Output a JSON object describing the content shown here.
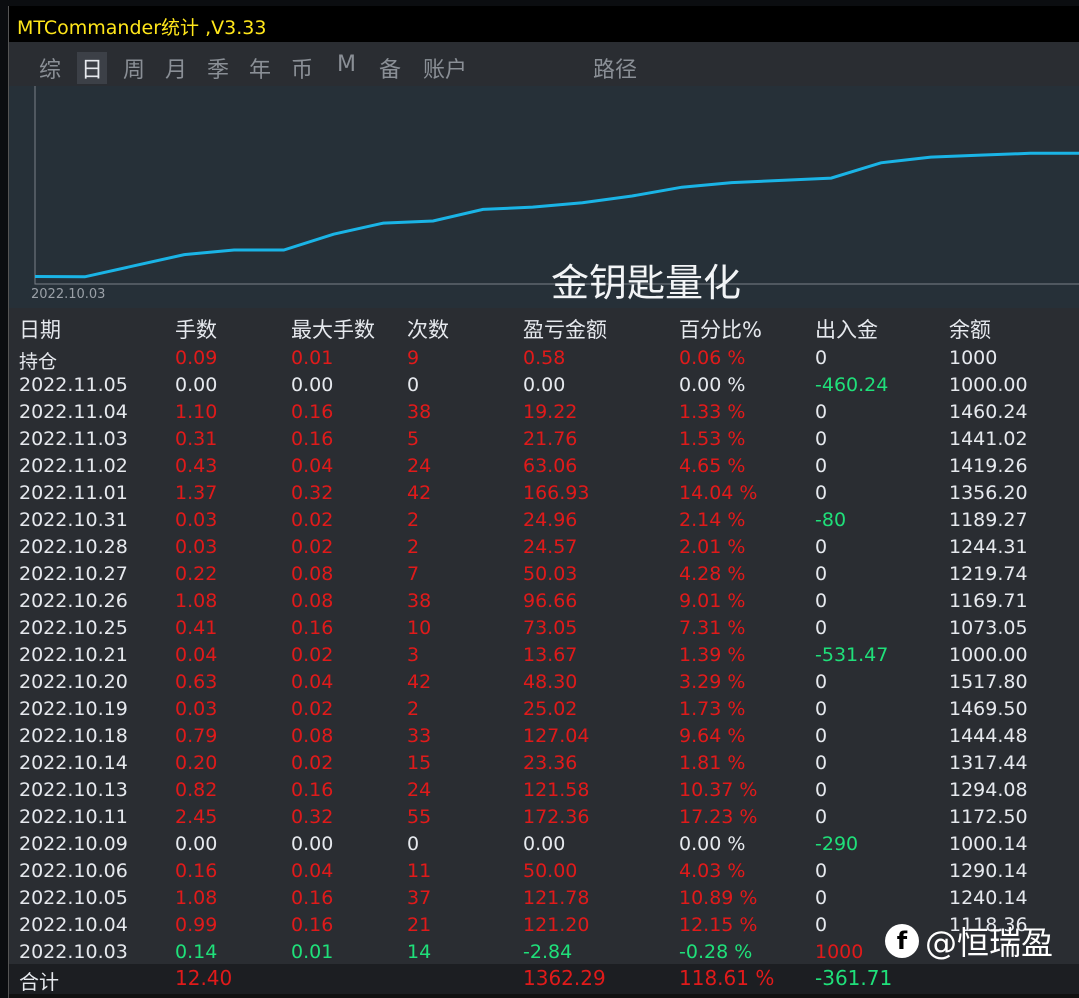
{
  "window": {
    "title": "MTCommander统计 ,V3.33"
  },
  "tabs": [
    {
      "label": "综",
      "active": false
    },
    {
      "label": "日",
      "active": true
    },
    {
      "label": "周",
      "active": false
    },
    {
      "label": "月",
      "active": false
    },
    {
      "label": "季",
      "active": false
    },
    {
      "label": "年",
      "active": false
    },
    {
      "label": "币",
      "active": false
    },
    {
      "label": "M",
      "active": false
    },
    {
      "label": "备",
      "active": false
    },
    {
      "label": "账户",
      "active": false
    },
    {
      "label": "路径",
      "active": false
    }
  ],
  "chart": {
    "start_date": "2022.10.03",
    "watermark": "金钥匙量化",
    "line_color": "#1ab4e6"
  },
  "chart_data": {
    "type": "line",
    "x": [
      "2022.10.03",
      "2022.10.04",
      "2022.10.05",
      "2022.10.06",
      "2022.10.09",
      "2022.10.11",
      "2022.10.13",
      "2022.10.14",
      "2022.10.18",
      "2022.10.19",
      "2022.10.20",
      "2022.10.21",
      "2022.10.25",
      "2022.10.26",
      "2022.10.27",
      "2022.10.28",
      "2022.10.31",
      "2022.11.01",
      "2022.11.02",
      "2022.11.03",
      "2022.11.04",
      "2022.11.05"
    ],
    "series": [
      {
        "values": [
          0,
          -2.84,
          118.36,
          240.14,
          290.14,
          290.14,
          462.5,
          584.08,
          607.44,
          734.48,
          759.5,
          807.8,
          880.85,
          977.51,
          1027.54,
          1052.11,
          1077.07,
          1244.0,
          1307.06,
          1328.82,
          1348.04,
          1348.04
        ]
      }
    ],
    "grid": false
  },
  "table": {
    "headers": [
      "日期",
      "手数",
      "最大手数",
      "次数",
      "盈亏金额",
      "百分比%",
      "出入金",
      "余额"
    ],
    "rows": [
      {
        "date": "持仓",
        "lots": "0.09",
        "max_lots": "0.01",
        "count": "9",
        "pnl": "0.58",
        "pct": "0.06 %",
        "flow": "0",
        "balance": "1000",
        "tone": "red",
        "flow_tone": "white"
      },
      {
        "date": "2022.11.05",
        "lots": "0.00",
        "max_lots": "0.00",
        "count": "0",
        "pnl": "0.00",
        "pct": "0.00 %",
        "flow": "-460.24",
        "balance": "1000.00",
        "tone": "white",
        "flow_tone": "green"
      },
      {
        "date": "2022.11.04",
        "lots": "1.10",
        "max_lots": "0.16",
        "count": "38",
        "pnl": "19.22",
        "pct": "1.33 %",
        "flow": "0",
        "balance": "1460.24",
        "tone": "red",
        "flow_tone": "white"
      },
      {
        "date": "2022.11.03",
        "lots": "0.31",
        "max_lots": "0.16",
        "count": "5",
        "pnl": "21.76",
        "pct": "1.53 %",
        "flow": "0",
        "balance": "1441.02",
        "tone": "red",
        "flow_tone": "white"
      },
      {
        "date": "2022.11.02",
        "lots": "0.43",
        "max_lots": "0.04",
        "count": "24",
        "pnl": "63.06",
        "pct": "4.65 %",
        "flow": "0",
        "balance": "1419.26",
        "tone": "red",
        "flow_tone": "white"
      },
      {
        "date": "2022.11.01",
        "lots": "1.37",
        "max_lots": "0.32",
        "count": "42",
        "pnl": "166.93",
        "pct": "14.04 %",
        "flow": "0",
        "balance": "1356.20",
        "tone": "red",
        "flow_tone": "white"
      },
      {
        "date": "2022.10.31",
        "lots": "0.03",
        "max_lots": "0.02",
        "count": "2",
        "pnl": "24.96",
        "pct": "2.14 %",
        "flow": "-80",
        "balance": "1189.27",
        "tone": "red",
        "flow_tone": "green"
      },
      {
        "date": "2022.10.28",
        "lots": "0.03",
        "max_lots": "0.02",
        "count": "2",
        "pnl": "24.57",
        "pct": "2.01 %",
        "flow": "0",
        "balance": "1244.31",
        "tone": "red",
        "flow_tone": "white"
      },
      {
        "date": "2022.10.27",
        "lots": "0.22",
        "max_lots": "0.08",
        "count": "7",
        "pnl": "50.03",
        "pct": "4.28 %",
        "flow": "0",
        "balance": "1219.74",
        "tone": "red",
        "flow_tone": "white"
      },
      {
        "date": "2022.10.26",
        "lots": "1.08",
        "max_lots": "0.08",
        "count": "38",
        "pnl": "96.66",
        "pct": "9.01 %",
        "flow": "0",
        "balance": "1169.71",
        "tone": "red",
        "flow_tone": "white"
      },
      {
        "date": "2022.10.25",
        "lots": "0.41",
        "max_lots": "0.16",
        "count": "10",
        "pnl": "73.05",
        "pct": "7.31 %",
        "flow": "0",
        "balance": "1073.05",
        "tone": "red",
        "flow_tone": "white"
      },
      {
        "date": "2022.10.21",
        "lots": "0.04",
        "max_lots": "0.02",
        "count": "3",
        "pnl": "13.67",
        "pct": "1.39 %",
        "flow": "-531.47",
        "balance": "1000.00",
        "tone": "red",
        "flow_tone": "green"
      },
      {
        "date": "2022.10.20",
        "lots": "0.63",
        "max_lots": "0.04",
        "count": "42",
        "pnl": "48.30",
        "pct": "3.29 %",
        "flow": "0",
        "balance": "1517.80",
        "tone": "red",
        "flow_tone": "white"
      },
      {
        "date": "2022.10.19",
        "lots": "0.03",
        "max_lots": "0.02",
        "count": "2",
        "pnl": "25.02",
        "pct": "1.73 %",
        "flow": "0",
        "balance": "1469.50",
        "tone": "red",
        "flow_tone": "white"
      },
      {
        "date": "2022.10.18",
        "lots": "0.79",
        "max_lots": "0.08",
        "count": "33",
        "pnl": "127.04",
        "pct": "9.64 %",
        "flow": "0",
        "balance": "1444.48",
        "tone": "red",
        "flow_tone": "white"
      },
      {
        "date": "2022.10.14",
        "lots": "0.20",
        "max_lots": "0.02",
        "count": "15",
        "pnl": "23.36",
        "pct": "1.81 %",
        "flow": "0",
        "balance": "1317.44",
        "tone": "red",
        "flow_tone": "white"
      },
      {
        "date": "2022.10.13",
        "lots": "0.82",
        "max_lots": "0.16",
        "count": "24",
        "pnl": "121.58",
        "pct": "10.37 %",
        "flow": "0",
        "balance": "1294.08",
        "tone": "red",
        "flow_tone": "white"
      },
      {
        "date": "2022.10.11",
        "lots": "2.45",
        "max_lots": "0.32",
        "count": "55",
        "pnl": "172.36",
        "pct": "17.23 %",
        "flow": "0",
        "balance": "1172.50",
        "tone": "red",
        "flow_tone": "white"
      },
      {
        "date": "2022.10.09",
        "lots": "0.00",
        "max_lots": "0.00",
        "count": "0",
        "pnl": "0.00",
        "pct": "0.00 %",
        "flow": "-290",
        "balance": "1000.14",
        "tone": "white",
        "flow_tone": "green"
      },
      {
        "date": "2022.10.06",
        "lots": "0.16",
        "max_lots": "0.04",
        "count": "11",
        "pnl": "50.00",
        "pct": "4.03 %",
        "flow": "0",
        "balance": "1290.14",
        "tone": "red",
        "flow_tone": "white"
      },
      {
        "date": "2022.10.05",
        "lots": "1.08",
        "max_lots": "0.16",
        "count": "37",
        "pnl": "121.78",
        "pct": "10.89 %",
        "flow": "0",
        "balance": "1240.14",
        "tone": "red",
        "flow_tone": "white"
      },
      {
        "date": "2022.10.04",
        "lots": "0.99",
        "max_lots": "0.16",
        "count": "21",
        "pnl": "121.20",
        "pct": "12.15 %",
        "flow": "0",
        "balance": "1118.36",
        "tone": "red",
        "flow_tone": "white"
      },
      {
        "date": "2022.10.03",
        "lots": "0.14",
        "max_lots": "0.01",
        "count": "14",
        "pnl": "-2.84",
        "pct": "-0.28 %",
        "flow": "1000",
        "balance": "",
        "tone": "green",
        "flow_tone": "red"
      }
    ],
    "total": {
      "label": "合计",
      "lots": "12.40",
      "pnl": "1362.29",
      "pct": "118.61 %",
      "flow": "-361.71"
    }
  },
  "watermark_social": {
    "text": "@恒瑞盈",
    "icon": "facebook-icon"
  }
}
